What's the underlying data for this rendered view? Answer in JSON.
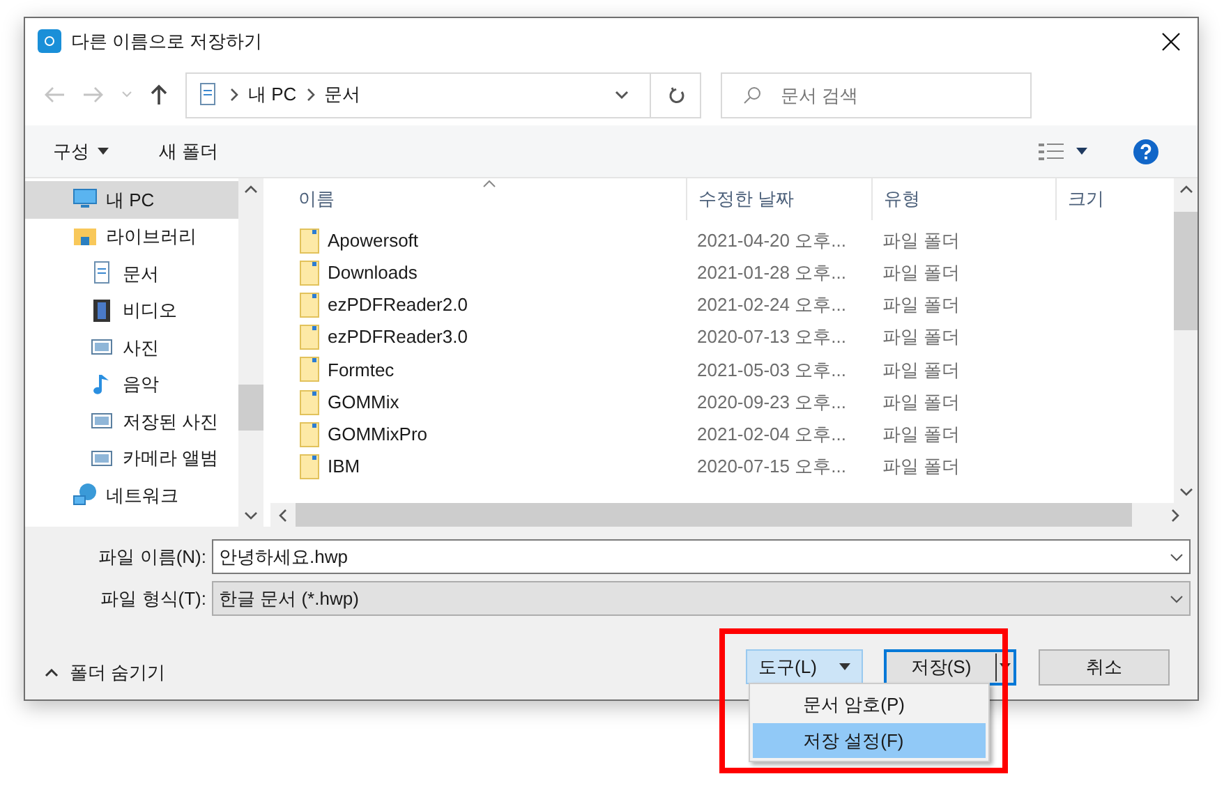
{
  "window": {
    "title": "다른 이름으로 저장하기"
  },
  "address": {
    "path": [
      "내 PC",
      "문서"
    ]
  },
  "search": {
    "placeholder": "문서 검색"
  },
  "toolbar": {
    "organize": "구성",
    "new_folder": "새 폴더"
  },
  "sidebar": {
    "items": [
      {
        "label": "내 PC",
        "kind": "pc",
        "selected": true
      },
      {
        "label": "라이브러리",
        "kind": "library",
        "selected": false,
        "children": [
          {
            "label": "문서",
            "kind": "document",
            "selected": false
          },
          {
            "label": "비디오",
            "kind": "video",
            "selected": false
          },
          {
            "label": "사진",
            "kind": "picture",
            "selected": false
          },
          {
            "label": "음악",
            "kind": "music",
            "selected": false
          },
          {
            "label": "저장된 사진",
            "kind": "picture",
            "selected": false
          },
          {
            "label": "카메라 앨범",
            "kind": "picture",
            "selected": false
          }
        ]
      },
      {
        "label": "네트워크",
        "kind": "network",
        "selected": false
      }
    ]
  },
  "table": {
    "columns": [
      "이름",
      "수정한 날짜",
      "유형",
      "크기"
    ],
    "rows": [
      {
        "name": "Apowersoft",
        "date": "2021-04-20 오후...",
        "type": "파일 폴더"
      },
      {
        "name": "Downloads",
        "date": "2021-01-28 오후...",
        "type": "파일 폴더"
      },
      {
        "name": "ezPDFReader2.0",
        "date": "2021-02-24 오후...",
        "type": "파일 폴더"
      },
      {
        "name": "ezPDFReader3.0",
        "date": "2020-07-13 오후...",
        "type": "파일 폴더"
      },
      {
        "name": "Formtec",
        "date": "2021-05-03 오후...",
        "type": "파일 폴더"
      },
      {
        "name": "GOMMix",
        "date": "2020-09-23 오후...",
        "type": "파일 폴더"
      },
      {
        "name": "GOMMixPro",
        "date": "2021-02-04 오후...",
        "type": "파일 폴더"
      },
      {
        "name": "IBM",
        "date": "2020-07-15 오후...",
        "type": "파일 폴더"
      }
    ]
  },
  "filename": {
    "label": "파일 이름(N):",
    "value": "안녕하세요.hwp"
  },
  "filetype": {
    "label": "파일 형식(T):",
    "value": "한글 문서 (*.hwp)"
  },
  "hide_folders": "폴더 숨기기",
  "tools_button": {
    "label": "도구(L)",
    "expanded": true
  },
  "save_button": {
    "label": "저장(S)"
  },
  "cancel_button": {
    "label": "취소"
  },
  "menu": {
    "items": [
      {
        "label": "문서 암호(P)",
        "selected": false
      },
      {
        "label": "저장 설정(F)",
        "selected": true
      }
    ]
  },
  "annotation": {
    "visible": true
  }
}
